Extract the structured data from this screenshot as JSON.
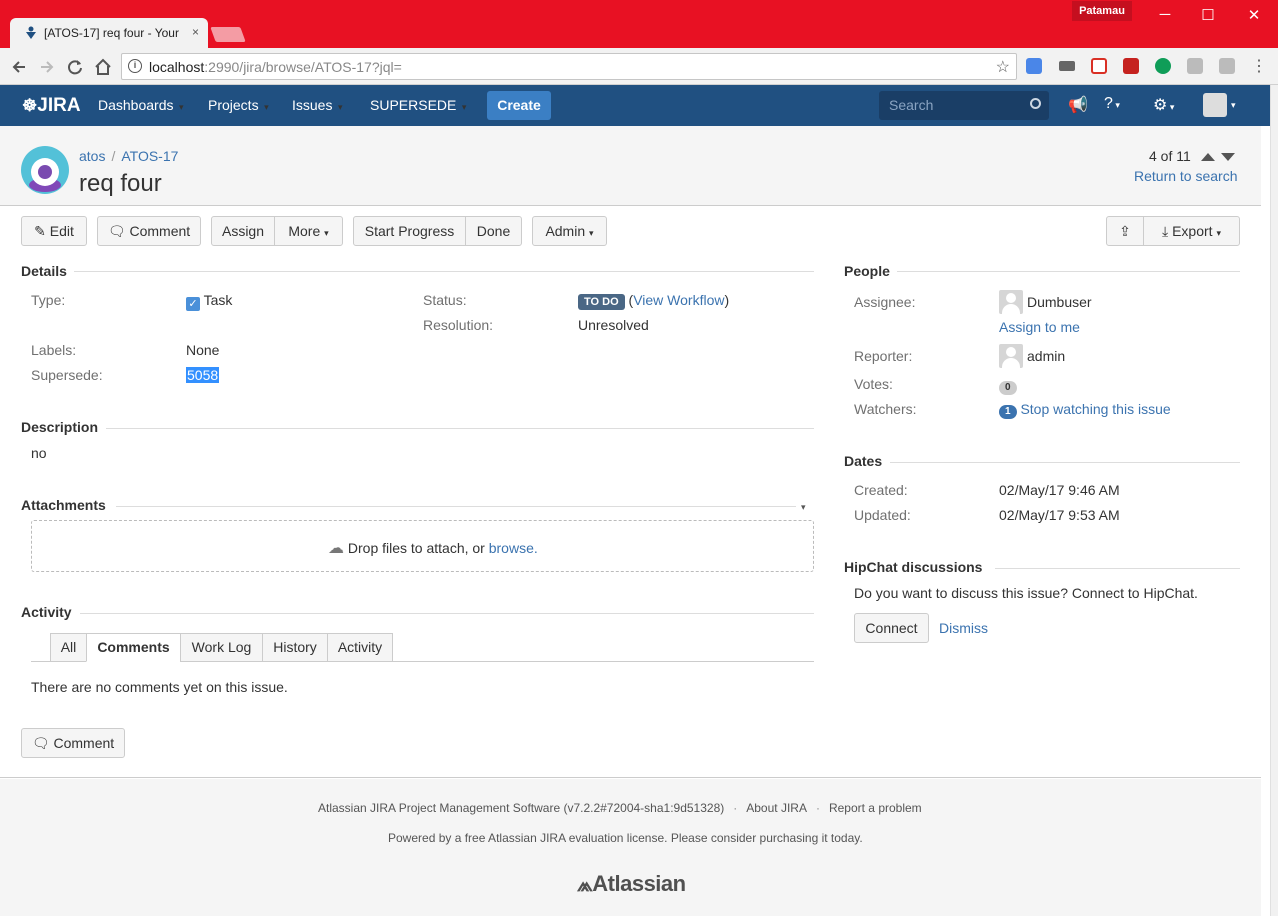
{
  "browser": {
    "tab_title": "[ATOS-17] req four - Your",
    "tab_close": "×",
    "profile_name": "Patamau",
    "url_host": "localhost",
    "url_path": ":2990/jira/browse/ATOS-17?jql=",
    "min_glyph": "─",
    "max_glyph": "☐",
    "close_glyph": "✕"
  },
  "jira_nav": {
    "logo": "JIRA",
    "items": [
      "Dashboards",
      "Projects",
      "Issues",
      "SUPERSEDE"
    ],
    "create": "Create",
    "search_placeholder": "Search"
  },
  "issue": {
    "project": "atos",
    "key": "ATOS-17",
    "summary": "req four",
    "pager": "4 of 11",
    "return_to_search": "Return to search"
  },
  "actions": {
    "edit": "Edit",
    "comment": "Comment",
    "assign": "Assign",
    "more": "More",
    "start_progress": "Start Progress",
    "done": "Done",
    "admin": "Admin",
    "export": "Export"
  },
  "details": {
    "heading": "Details",
    "type_label": "Type:",
    "type_value": "Task",
    "status_label": "Status:",
    "status_value": "TO DO",
    "view_workflow": "View Workflow",
    "resolution_label": "Resolution:",
    "resolution_value": "Unresolved",
    "labels_label": "Labels:",
    "labels_value": "None",
    "supersede_label": "Supersede:",
    "supersede_value": "5058"
  },
  "description": {
    "heading": "Description",
    "text": "no"
  },
  "attachments": {
    "heading": "Attachments",
    "drop_text": "Drop files to attach, or",
    "browse": "browse."
  },
  "activity": {
    "heading": "Activity",
    "tabs": [
      "All",
      "Comments",
      "Work Log",
      "History",
      "Activity"
    ],
    "active_tab": "Comments",
    "empty_text": "There are no comments yet on this issue.",
    "comment_button": "Comment"
  },
  "people": {
    "heading": "People",
    "assignee_label": "Assignee:",
    "assignee": "Dumbuser",
    "assign_to_me": "Assign to me",
    "reporter_label": "Reporter:",
    "reporter": "admin",
    "votes_label": "Votes:",
    "votes": "0",
    "watchers_label": "Watchers:",
    "watchers": "1",
    "stop_watching": "Stop watching this issue"
  },
  "dates": {
    "heading": "Dates",
    "created_label": "Created:",
    "created": "02/May/17 9:46 AM",
    "updated_label": "Updated:",
    "updated": "02/May/17 9:53 AM"
  },
  "hipchat": {
    "heading": "HipChat discussions",
    "text": "Do you want to discuss this issue? Connect to HipChat.",
    "connect": "Connect",
    "dismiss": "Dismiss"
  },
  "footer": {
    "software": "Atlassian JIRA Project Management Software (v7.2.2#72004-sha1:9d51328)",
    "about": "About JIRA",
    "report": "Report a problem",
    "license": "Powered by a free Atlassian JIRA evaluation license. Please consider purchasing it today.",
    "logo": "Atlassian"
  },
  "colors": {
    "header": "#205081",
    "link": "#3b73af",
    "chrome": "#e81123",
    "status": "#4a6785"
  }
}
